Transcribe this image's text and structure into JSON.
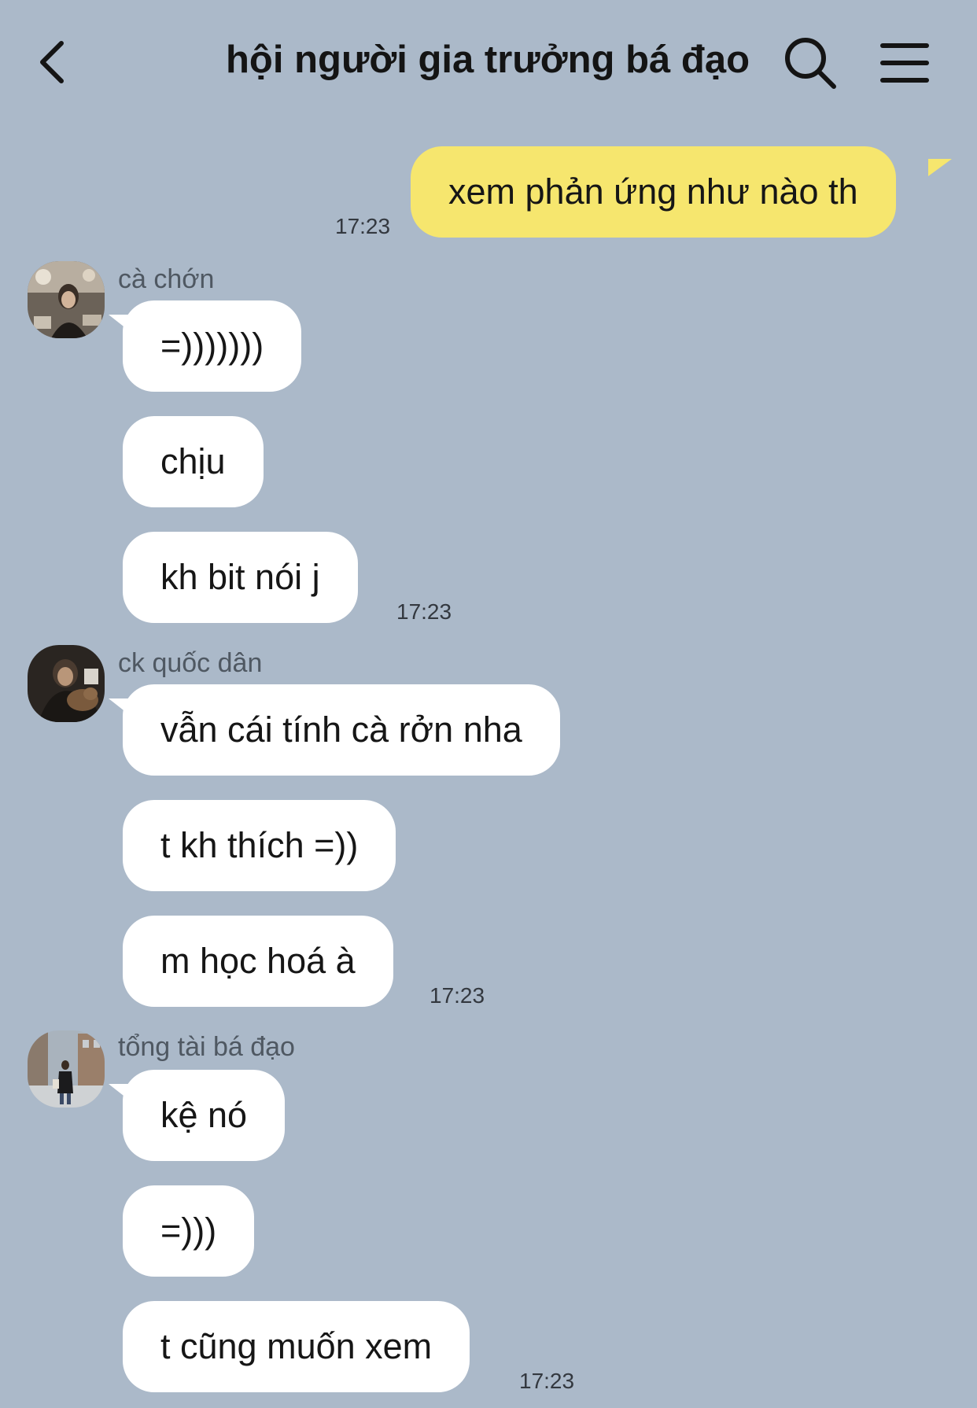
{
  "header": {
    "title": "hội người gia trưởng bá đạo"
  },
  "my_message": {
    "text": "xem phản ứng như nào th",
    "time": "17:23"
  },
  "groups": [
    {
      "sender": "cà chớn",
      "messages": [
        "=)))))))",
        "chịu",
        "kh bit nói j"
      ],
      "time": "17:23"
    },
    {
      "sender": "ck quốc dân",
      "messages": [
        "vẫn cái tính cà rởn nha",
        "t kh thích =))",
        "m học hoá à"
      ],
      "time": "17:23"
    },
    {
      "sender": "tổng tài bá đạo",
      "messages": [
        "kệ nó",
        "=)))",
        "t cũng muốn xem"
      ],
      "time": "17:23"
    }
  ],
  "colors": {
    "background": "#abb9c9",
    "my_bubble": "#f6e66e",
    "their_bubble": "#ffffff"
  },
  "icons": {
    "back": "chevron-left-icon",
    "search": "search-icon",
    "menu": "hamburger-menu-icon"
  }
}
